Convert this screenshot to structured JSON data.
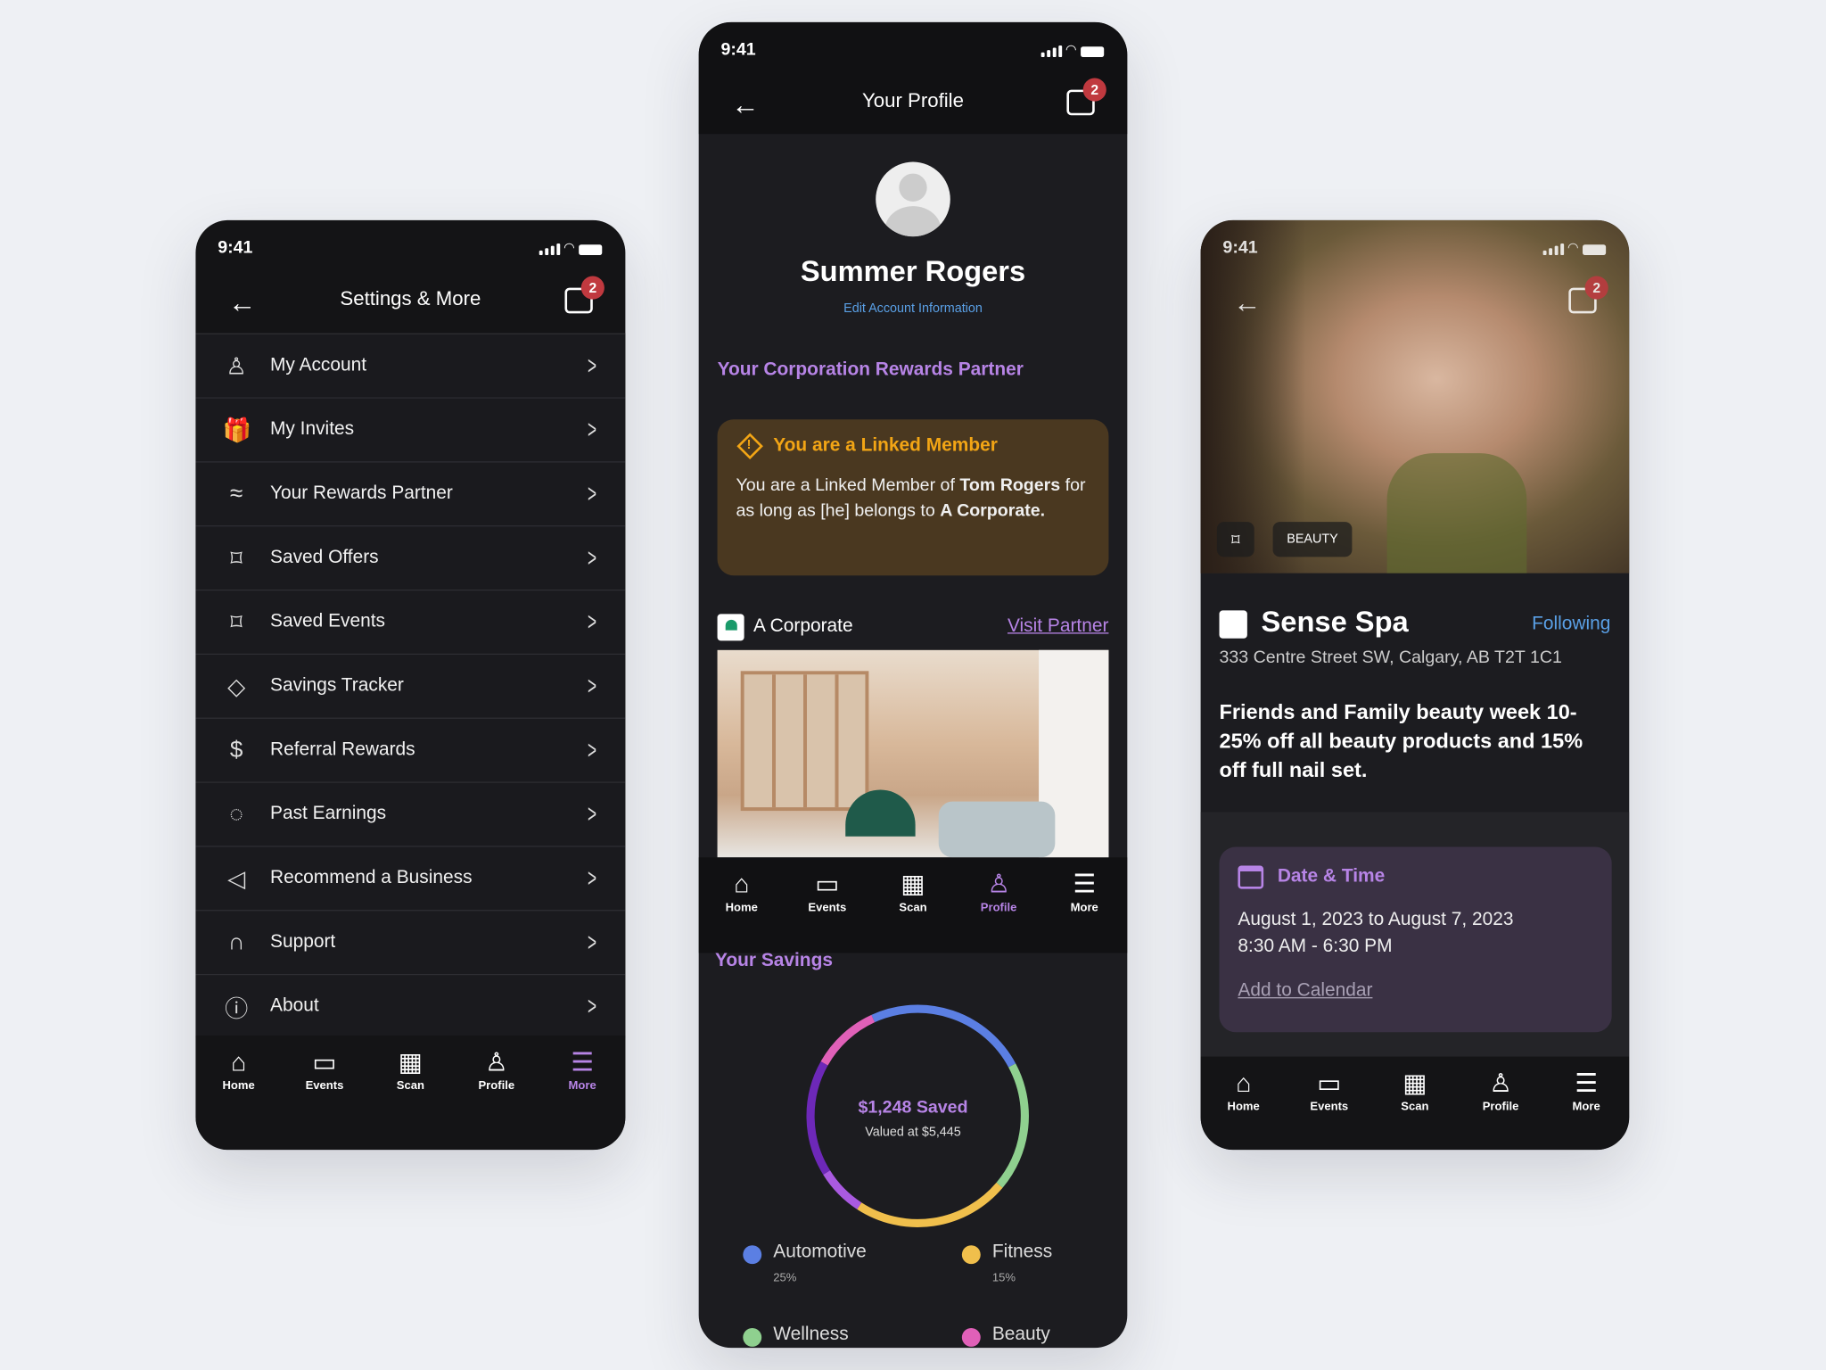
{
  "status": {
    "time": "9:41"
  },
  "colors": {
    "accent": "#b784e6",
    "warning": "#f2a515",
    "link_blue": "#5aa0e6"
  },
  "nav": [
    {
      "label": "Home",
      "icon": "home-icon"
    },
    {
      "label": "Events",
      "icon": "calendar-icon"
    },
    {
      "label": "Scan",
      "icon": "qr-code-icon"
    },
    {
      "label": "Profile",
      "icon": "user-icon"
    },
    {
      "label": "More",
      "icon": "menu-icon"
    }
  ],
  "settings": {
    "title": "Settings & More",
    "badge": "2",
    "active_tab": "More",
    "items": [
      {
        "label": "My Account",
        "icon": "user-edit-icon"
      },
      {
        "label": "My Invites",
        "icon": "gift-icon"
      },
      {
        "label": "Your Rewards Partner",
        "icon": "handshake-icon"
      },
      {
        "label": "Saved Offers",
        "icon": "bookmark-icon"
      },
      {
        "label": "Saved Events",
        "icon": "bookmark-icon"
      },
      {
        "label": "Savings Tracker",
        "icon": "tag-icon"
      },
      {
        "label": "Referral Rewards",
        "icon": "dollar-icon"
      },
      {
        "label": "Past Earnings",
        "icon": "piggy-bank-icon"
      },
      {
        "label": "Recommend a Business",
        "icon": "megaphone-icon"
      },
      {
        "label": "Support",
        "icon": "headset-icon"
      },
      {
        "label": "About",
        "icon": "info-icon"
      }
    ]
  },
  "profile": {
    "title": "Your Profile",
    "badge": "2",
    "active_tab": "Profile",
    "name": "Summer Rogers",
    "edit_link": "Edit Account Information",
    "section_title": "Your Corporation Rewards Partner",
    "warning": {
      "title": "You are a Linked Member",
      "text_1": "You are a Linked Member of ",
      "name": "Tom Rogers",
      "text_2": " for as long as [he] belongs to ",
      "org": "A Corporate."
    },
    "partner": {
      "name": "A Corporate",
      "link": "Visit Partner"
    },
    "savings_title": "Your Savings",
    "saved": "$1,248 Saved",
    "valued": "Valued at $5,445"
  },
  "chart_data": {
    "type": "pie",
    "style": "donut",
    "center_label": "$1,248 Saved",
    "center_sublabel": "Valued at $5,445",
    "segments": [
      {
        "name": "Automotive",
        "value": 24,
        "color": "#5b7fe3"
      },
      {
        "name": "Wellness",
        "value": 19,
        "color": "#8fd08f"
      },
      {
        "name": "Fitness",
        "value": 23,
        "color": "#f0bf4c"
      },
      {
        "value": 7,
        "color": "#a95ae0"
      },
      {
        "value": 17,
        "color": "#6d28b8"
      },
      {
        "name": "Beauty",
        "value": 10,
        "color": "#e060b8"
      }
    ],
    "legend": [
      {
        "name": "Automotive",
        "percent": "25%",
        "color": "#5b7fe3"
      },
      {
        "name": "Fitness",
        "percent": "15%",
        "color": "#f0bf4c"
      },
      {
        "name": "Wellness",
        "color": "#8fd08f"
      },
      {
        "name": "Beauty",
        "color": "#e060b8"
      }
    ],
    "legend_placement": "bottom"
  },
  "spa": {
    "badge": "2",
    "tag": "BEAUTY",
    "name": "Sense Spa",
    "follow": "Following",
    "address": "333 Centre Street SW, Calgary, AB T2T 1C1",
    "description": "Friends and Family beauty week 10-25% off all beauty products and 15% off full nail set.",
    "date_title": "Date & Time",
    "dates": "August 1, 2023 to August 7, 2023",
    "hours": "8:30 AM - 6:30 PM",
    "calendar_link": "Add to Calendar"
  }
}
